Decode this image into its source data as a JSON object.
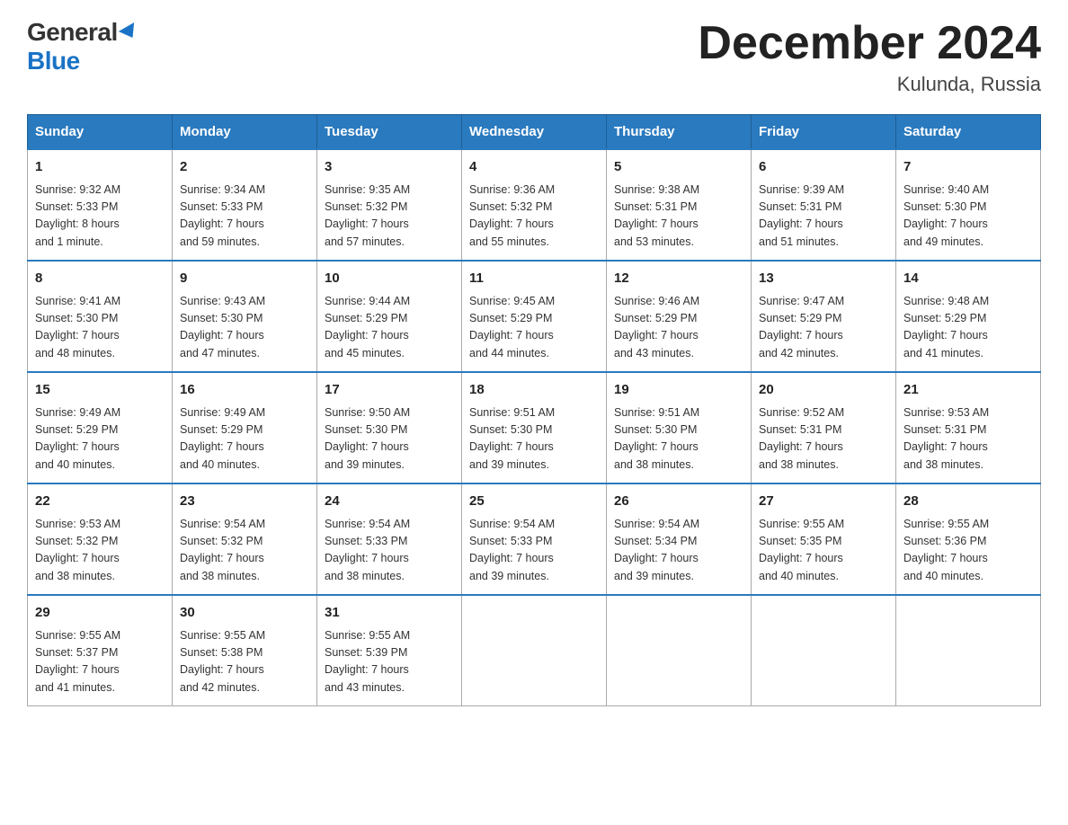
{
  "logo": {
    "general": "General",
    "blue": "Blue"
  },
  "title": "December 2024",
  "subtitle": "Kulunda, Russia",
  "days_of_week": [
    "Sunday",
    "Monday",
    "Tuesday",
    "Wednesday",
    "Thursday",
    "Friday",
    "Saturday"
  ],
  "weeks": [
    [
      {
        "day": "1",
        "info": "Sunrise: 9:32 AM\nSunset: 5:33 PM\nDaylight: 8 hours\nand 1 minute."
      },
      {
        "day": "2",
        "info": "Sunrise: 9:34 AM\nSunset: 5:33 PM\nDaylight: 7 hours\nand 59 minutes."
      },
      {
        "day": "3",
        "info": "Sunrise: 9:35 AM\nSunset: 5:32 PM\nDaylight: 7 hours\nand 57 minutes."
      },
      {
        "day": "4",
        "info": "Sunrise: 9:36 AM\nSunset: 5:32 PM\nDaylight: 7 hours\nand 55 minutes."
      },
      {
        "day": "5",
        "info": "Sunrise: 9:38 AM\nSunset: 5:31 PM\nDaylight: 7 hours\nand 53 minutes."
      },
      {
        "day": "6",
        "info": "Sunrise: 9:39 AM\nSunset: 5:31 PM\nDaylight: 7 hours\nand 51 minutes."
      },
      {
        "day": "7",
        "info": "Sunrise: 9:40 AM\nSunset: 5:30 PM\nDaylight: 7 hours\nand 49 minutes."
      }
    ],
    [
      {
        "day": "8",
        "info": "Sunrise: 9:41 AM\nSunset: 5:30 PM\nDaylight: 7 hours\nand 48 minutes."
      },
      {
        "day": "9",
        "info": "Sunrise: 9:43 AM\nSunset: 5:30 PM\nDaylight: 7 hours\nand 47 minutes."
      },
      {
        "day": "10",
        "info": "Sunrise: 9:44 AM\nSunset: 5:29 PM\nDaylight: 7 hours\nand 45 minutes."
      },
      {
        "day": "11",
        "info": "Sunrise: 9:45 AM\nSunset: 5:29 PM\nDaylight: 7 hours\nand 44 minutes."
      },
      {
        "day": "12",
        "info": "Sunrise: 9:46 AM\nSunset: 5:29 PM\nDaylight: 7 hours\nand 43 minutes."
      },
      {
        "day": "13",
        "info": "Sunrise: 9:47 AM\nSunset: 5:29 PM\nDaylight: 7 hours\nand 42 minutes."
      },
      {
        "day": "14",
        "info": "Sunrise: 9:48 AM\nSunset: 5:29 PM\nDaylight: 7 hours\nand 41 minutes."
      }
    ],
    [
      {
        "day": "15",
        "info": "Sunrise: 9:49 AM\nSunset: 5:29 PM\nDaylight: 7 hours\nand 40 minutes."
      },
      {
        "day": "16",
        "info": "Sunrise: 9:49 AM\nSunset: 5:29 PM\nDaylight: 7 hours\nand 40 minutes."
      },
      {
        "day": "17",
        "info": "Sunrise: 9:50 AM\nSunset: 5:30 PM\nDaylight: 7 hours\nand 39 minutes."
      },
      {
        "day": "18",
        "info": "Sunrise: 9:51 AM\nSunset: 5:30 PM\nDaylight: 7 hours\nand 39 minutes."
      },
      {
        "day": "19",
        "info": "Sunrise: 9:51 AM\nSunset: 5:30 PM\nDaylight: 7 hours\nand 38 minutes."
      },
      {
        "day": "20",
        "info": "Sunrise: 9:52 AM\nSunset: 5:31 PM\nDaylight: 7 hours\nand 38 minutes."
      },
      {
        "day": "21",
        "info": "Sunrise: 9:53 AM\nSunset: 5:31 PM\nDaylight: 7 hours\nand 38 minutes."
      }
    ],
    [
      {
        "day": "22",
        "info": "Sunrise: 9:53 AM\nSunset: 5:32 PM\nDaylight: 7 hours\nand 38 minutes."
      },
      {
        "day": "23",
        "info": "Sunrise: 9:54 AM\nSunset: 5:32 PM\nDaylight: 7 hours\nand 38 minutes."
      },
      {
        "day": "24",
        "info": "Sunrise: 9:54 AM\nSunset: 5:33 PM\nDaylight: 7 hours\nand 38 minutes."
      },
      {
        "day": "25",
        "info": "Sunrise: 9:54 AM\nSunset: 5:33 PM\nDaylight: 7 hours\nand 39 minutes."
      },
      {
        "day": "26",
        "info": "Sunrise: 9:54 AM\nSunset: 5:34 PM\nDaylight: 7 hours\nand 39 minutes."
      },
      {
        "day": "27",
        "info": "Sunrise: 9:55 AM\nSunset: 5:35 PM\nDaylight: 7 hours\nand 40 minutes."
      },
      {
        "day": "28",
        "info": "Sunrise: 9:55 AM\nSunset: 5:36 PM\nDaylight: 7 hours\nand 40 minutes."
      }
    ],
    [
      {
        "day": "29",
        "info": "Sunrise: 9:55 AM\nSunset: 5:37 PM\nDaylight: 7 hours\nand 41 minutes."
      },
      {
        "day": "30",
        "info": "Sunrise: 9:55 AM\nSunset: 5:38 PM\nDaylight: 7 hours\nand 42 minutes."
      },
      {
        "day": "31",
        "info": "Sunrise: 9:55 AM\nSunset: 5:39 PM\nDaylight: 7 hours\nand 43 minutes."
      },
      null,
      null,
      null,
      null
    ]
  ]
}
